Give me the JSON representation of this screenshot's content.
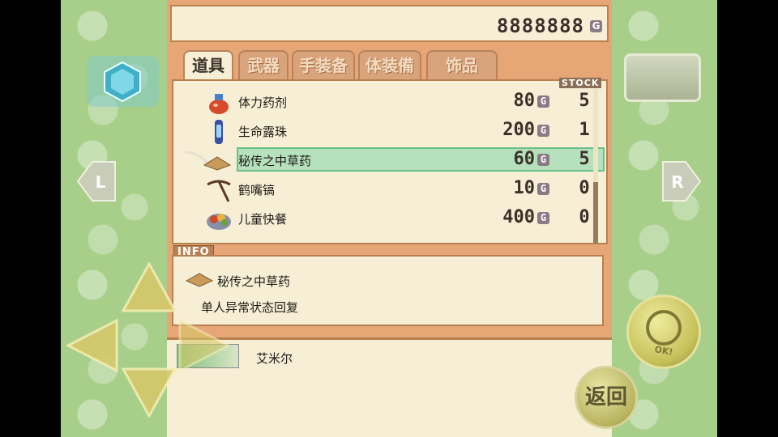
{
  "header": {
    "gold_amount": "8888888",
    "gold_unit": "G"
  },
  "tabs": [
    {
      "label": "道具",
      "active": true
    },
    {
      "label": "武器",
      "active": false
    },
    {
      "label": "手装备",
      "active": false
    },
    {
      "label": "体装備",
      "active": false
    },
    {
      "label": "饰品",
      "active": false
    }
  ],
  "list": {
    "stock_label": "STOCK",
    "items": [
      {
        "name": "体力药剂",
        "price": "80",
        "stock": "5",
        "icon": "potion-icon"
      },
      {
        "name": "生命露珠",
        "price": "200",
        "stock": "1",
        "icon": "dew-crystal-icon"
      },
      {
        "name": "秘传之中草药",
        "price": "60",
        "stock": "5",
        "icon": "herb-powder-icon",
        "selected": true
      },
      {
        "name": "鹤嘴镐",
        "price": "10",
        "stock": "0",
        "icon": "pickaxe-icon"
      },
      {
        "name": "儿童快餐",
        "price": "400",
        "stock": "0",
        "icon": "kids-meal-icon"
      }
    ],
    "currency_unit": "G"
  },
  "info": {
    "label": "INFO",
    "item_name": "秘传之中草药",
    "description": "单人异常状态回复"
  },
  "character": {
    "name": "艾米尔"
  },
  "controls": {
    "l_label": "L",
    "r_label": "R",
    "ok_label": "OK!",
    "return_label": "返回"
  },
  "colors": {
    "panel": "#f6efd6",
    "frame": "#e6a676",
    "selection": "#b6e1bd",
    "sidebar": "#a8cf8a"
  }
}
